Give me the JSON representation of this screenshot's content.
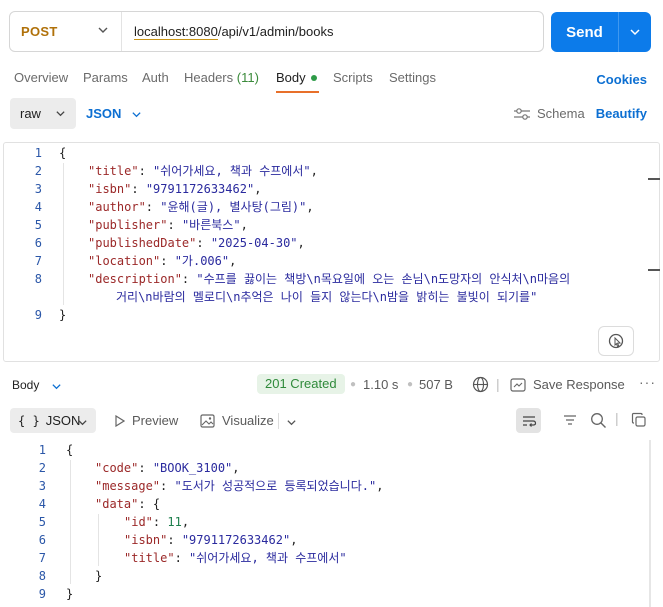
{
  "request": {
    "method": "POST",
    "url_host": "localhost:8080",
    "url_path": "/api/v1/admin/books",
    "send_label": "Send"
  },
  "tabs": {
    "overview": "Overview",
    "params": "Params",
    "auth": "Auth",
    "headers": "Headers",
    "headers_count": "(11)",
    "body": "Body",
    "scripts": "Scripts",
    "settings": "Settings",
    "cookies": "Cookies"
  },
  "body_toolbar": {
    "mode": "raw",
    "format": "JSON",
    "schema": "Schema",
    "beautify": "Beautify"
  },
  "request_body": {
    "line_numbers": [
      "1",
      "2",
      "3",
      "4",
      "5",
      "6",
      "7",
      "8",
      "9"
    ],
    "open_brace": "{",
    "close_brace": "}",
    "fields": [
      {
        "key": "\"title\"",
        "value": "\"쉬어가세요, 책과 수프에서\""
      },
      {
        "key": "\"isbn\"",
        "value": "\"9791172633462\""
      },
      {
        "key": "\"author\"",
        "value": "\"윤해(글), 별사탕(그림)\""
      },
      {
        "key": "\"publisher\"",
        "value": "\"바른북스\""
      },
      {
        "key": "\"publishedDate\"",
        "value": "\"2025-04-30\""
      },
      {
        "key": "\"location\"",
        "value": "\"가.006\""
      },
      {
        "key": "\"description\"",
        "value": "\"수프를 끓이는 책방\\n목요일에 오는 손님\\n도망자의 안식처\\n마음의"
      }
    ],
    "description_cont": "거리\\n바람의 멜로디\\n추억은 나이 들지 않는다\\n밤을 밝히는 불빛이 되기를\""
  },
  "response_bar": {
    "label": "Body",
    "status": "201 Created",
    "time": "1.10 s",
    "size": "507 B",
    "save": "Save Response",
    "more": "···"
  },
  "response_toolbar": {
    "format_braces": "{ }",
    "format": "JSON",
    "preview": "Preview",
    "visualize": "Visualize"
  },
  "response_body": {
    "line_numbers": [
      "1",
      "2",
      "3",
      "4",
      "5",
      "6",
      "7",
      "8",
      "9"
    ],
    "open_brace": "{",
    "close_brace": "}",
    "code_key": "\"code\"",
    "code_value": "\"BOOK_3100\"",
    "message_key": "\"message\"",
    "message_value": "\"도서가 성공적으로 등록되었습니다.\"",
    "data_key": "\"data\"",
    "data_open": "{",
    "data_close": "}",
    "id_key": "\"id\"",
    "id_value": "11",
    "isbn_key": "\"isbn\"",
    "isbn_value": "\"9791172633462\"",
    "title_key": "\"title\"",
    "title_value": "\"쉬어가세요, 책과 수프에서\""
  }
}
